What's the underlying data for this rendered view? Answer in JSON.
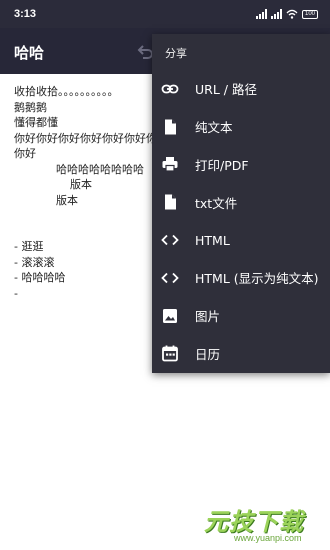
{
  "status_bar": {
    "time": "3:13",
    "battery": "100"
  },
  "app_bar": {
    "title": "哈哈"
  },
  "editor": {
    "lines": [
      "收拾收拾。。。。。。。。。。",
      "鹅鹅鹅",
      "懂得都懂",
      "你好你好你好你好你好你好你好",
      "你好",
      "            哈哈哈哈哈哈哈哈",
      "                版本",
      "            版本",
      "",
      "",
      "- 逛逛",
      "- 滚滚滚",
      "- 哈哈哈哈",
      "-"
    ]
  },
  "menu": {
    "header": "分享",
    "items": [
      {
        "label": "URL / 路径",
        "icon": "link-icon"
      },
      {
        "label": "纯文本",
        "icon": "file-icon"
      },
      {
        "label": "打印/PDF",
        "icon": "printer-icon"
      },
      {
        "label": "txt文件",
        "icon": "file-icon"
      },
      {
        "label": "HTML",
        "icon": "code-icon"
      },
      {
        "label": "HTML (显示为纯文本)",
        "icon": "code-icon"
      },
      {
        "label": "图片",
        "icon": "image-icon"
      },
      {
        "label": "日历",
        "icon": "calendar-icon"
      }
    ]
  },
  "watermark": {
    "logo": "元技下载",
    "url": "www.yuanpi.com"
  }
}
